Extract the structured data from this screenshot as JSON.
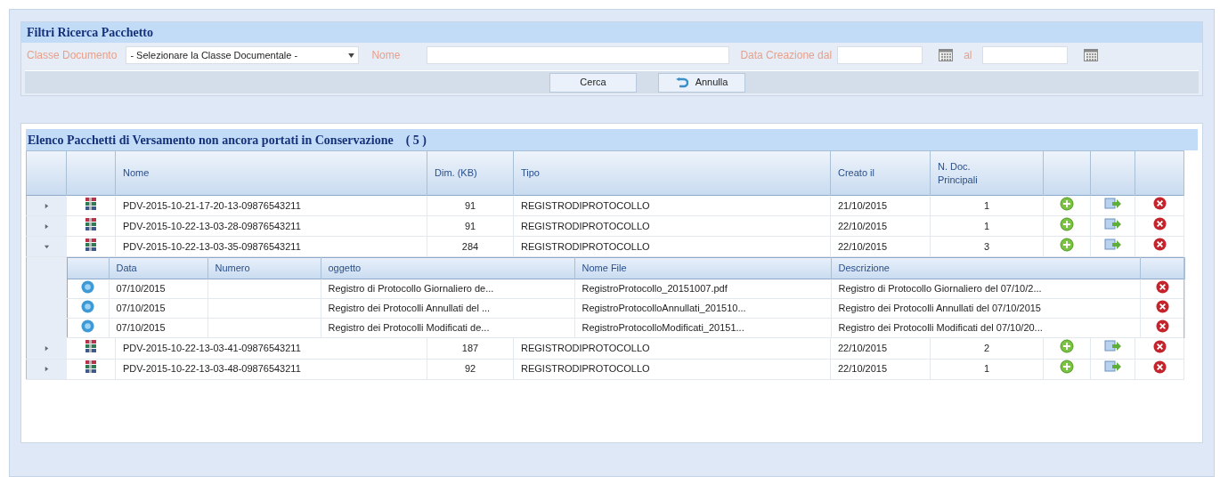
{
  "filters": {
    "title": "Filtri Ricerca Pacchetto",
    "class_label": "Classe Documento",
    "class_value": "- Selezionare la Classe Documentale -",
    "name_label": "Nome",
    "date_from_label": "Data Creazione dal",
    "date_to_label": "al",
    "buttons": [
      {
        "label": "Cerca",
        "kind": "plain"
      },
      {
        "label": "Annulla",
        "kind": "undo"
      }
    ]
  },
  "list": {
    "title": "Elenco Pacchetti di Versamento non ancora portati in Conservazione",
    "count": "( 5 )",
    "columns": [
      "Nome",
      "Dim. (KB)",
      "Tipo",
      "Creato il",
      "N. Doc.\nPrincipali"
    ],
    "rows": [
      {
        "expanded": false,
        "name": "PDV-2015-10-21-17-20-13-09876543211",
        "size": "91",
        "type": "REGISTRODIPROTOCOLLO",
        "created": "21/10/2015",
        "docs": "1"
      },
      {
        "expanded": false,
        "name": "PDV-2015-10-22-13-03-28-09876543211",
        "size": "91",
        "type": "REGISTRODIPROTOCOLLO",
        "created": "22/10/2015",
        "docs": "1"
      },
      {
        "expanded": true,
        "name": "PDV-2015-10-22-13-03-35-09876543211",
        "size": "284",
        "type": "REGISTRODIPROTOCOLLO",
        "created": "22/10/2015",
        "docs": "3",
        "detail": {
          "columns": [
            "Data",
            "Numero",
            "oggetto",
            "Nome File",
            "Descrizione"
          ],
          "rows": [
            {
              "date": "07/10/2015",
              "subject": "Registro di Protocollo Giornaliero de...",
              "file": "RegistroProtocollo_20151007.pdf",
              "description": "Registro di Protocollo Giornaliero del 07/10/2..."
            },
            {
              "date": "07/10/2015",
              "subject": "Registro dei Protocolli Annullati del ...",
              "file": "RegistroProtocolloAnnullati_201510...",
              "description": "Registro dei Protocolli Annullati del 07/10/2015"
            },
            {
              "date": "07/10/2015",
              "subject": "Registro dei Protocolli Modificati de...",
              "file": "RegistroProtocolloModificati_20151...",
              "description": "Registro dei Protocolli Modificati del 07/10/20..."
            }
          ]
        }
      },
      {
        "expanded": false,
        "name": "PDV-2015-10-22-13-03-41-09876543211",
        "size": "187",
        "type": "REGISTRODIPROTOCOLLO",
        "created": "22/10/2015",
        "docs": "2"
      },
      {
        "expanded": false,
        "name": "PDV-2015-10-22-13-03-48-09876543211",
        "size": "92",
        "type": "REGISTRODIPROTOCOLLO",
        "created": "22/10/2015",
        "docs": "1"
      }
    ]
  }
}
